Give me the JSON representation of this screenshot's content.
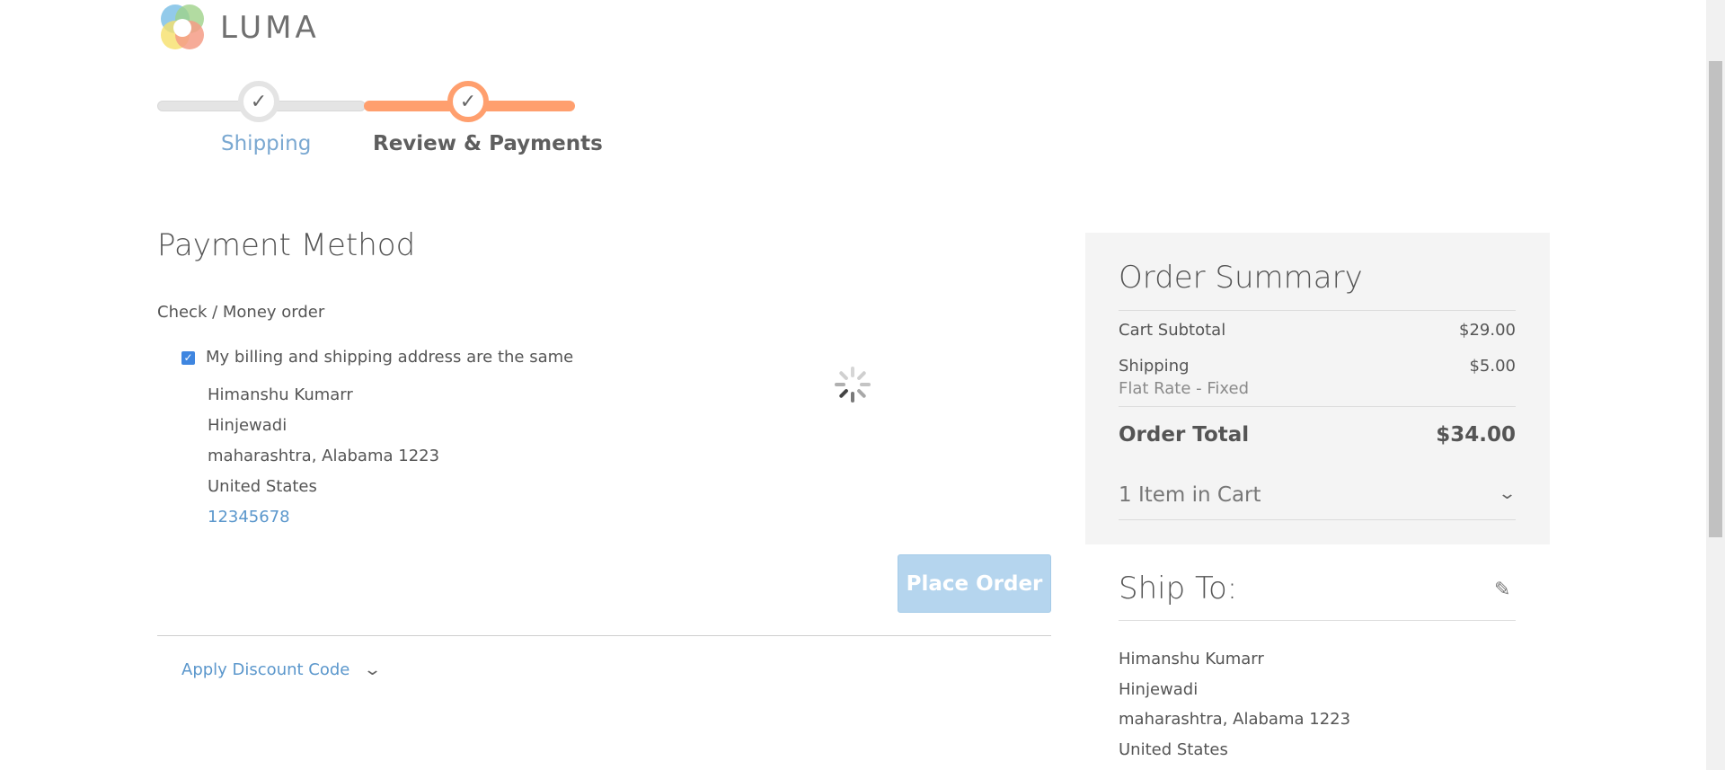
{
  "logo": {
    "text": "LUMA"
  },
  "progress": {
    "steps": [
      {
        "label": "Shipping",
        "state": "complete"
      },
      {
        "label": "Review & Payments",
        "state": "active"
      }
    ],
    "check_glyph": "✓"
  },
  "payment": {
    "title": "Payment Method",
    "method": "Check / Money order",
    "same_address_label": "My billing and shipping address are the same",
    "same_address_checked": true,
    "address": {
      "name": "Himanshu Kumarr",
      "street": "Hinjewadi",
      "city_line": "maharashtra, Alabama 1223",
      "country": "United States",
      "phone": "12345678"
    },
    "place_order_label": "Place Order",
    "discount_label": "Apply Discount Code"
  },
  "summary": {
    "title": "Order Summary",
    "subtotal_label": "Cart Subtotal",
    "subtotal_value": "$29.00",
    "shipping_label": "Shipping",
    "shipping_value": "$5.00",
    "shipping_method": "Flat Rate - Fixed",
    "total_label": "Order Total",
    "total_value": "$34.00",
    "items_in_cart": "1 Item in Cart"
  },
  "ship_to": {
    "title": "Ship To:",
    "name": "Himanshu Kumarr",
    "street": "Hinjewadi",
    "city_line": "maharashtra, Alabama 1223",
    "country": "United States"
  },
  "colors": {
    "accent_orange": "#ff9f6e",
    "link_blue": "#5b97cc",
    "button_disabled_blue": "#b5d5ee"
  },
  "icons": {
    "logo": "luma-logo-icon",
    "step_check": "checkmark-icon",
    "spinner": "loading-spinner-icon",
    "chevron": "chevron-down-icon",
    "edit": "pencil-icon"
  }
}
